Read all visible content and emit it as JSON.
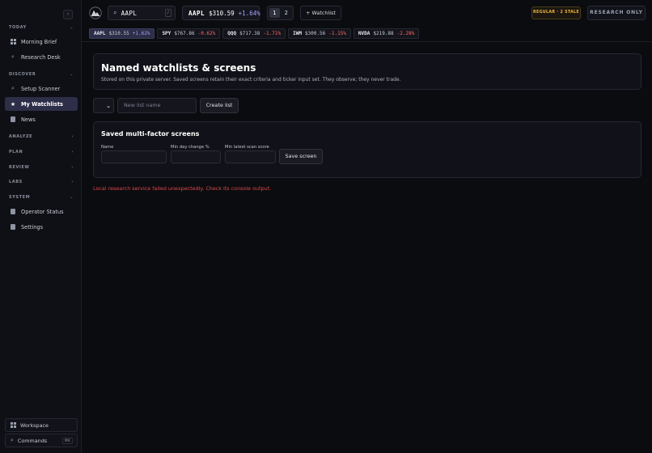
{
  "sidebar": {
    "collapse_glyph": "‹",
    "sections": [
      {
        "title": "TODAY",
        "chevron": "⌄"
      },
      {
        "title": "DISCOVER",
        "chevron": "⌄"
      },
      {
        "title": "ANALYZE",
        "chevron": "›"
      },
      {
        "title": "PLAN",
        "chevron": "›"
      },
      {
        "title": "REVIEW",
        "chevron": "›"
      },
      {
        "title": "LABS",
        "chevron": "›"
      },
      {
        "title": "SYSTEM",
        "chevron": "⌄"
      }
    ],
    "items": [
      {
        "label": "Morning Brief",
        "icon": "grid-icon"
      },
      {
        "label": "Research Desk",
        "icon": "search-icon"
      },
      {
        "label": "Setup Scanner",
        "icon": "search-icon"
      },
      {
        "label": "My Watchlists",
        "icon": "star-icon",
        "active": true
      },
      {
        "label": "News",
        "icon": "document-icon"
      },
      {
        "label": "Operator Status",
        "icon": "document-icon"
      },
      {
        "label": "Settings",
        "icon": "document-icon"
      }
    ],
    "bottom": {
      "workspace_label": "Workspace",
      "commands_label": "Commands",
      "commands_shortcut": "⌘K"
    }
  },
  "topbar": {
    "search_value": "AAPL",
    "search_shortcut": "/",
    "quote": {
      "symbol": "AAPL",
      "price": "$310.59",
      "change": "+1.64%"
    },
    "pages": [
      "1",
      "2"
    ],
    "active_page": "1",
    "watchlist_button": "+ Watchlist",
    "session_badge": "REGULAR · 2 STALE",
    "mode_badge": "RESEARCH ONLY"
  },
  "tickers": [
    {
      "symbol": "AAPL",
      "price": "$310.55",
      "change": "+1.62%",
      "direction": "up",
      "active": true
    },
    {
      "symbol": "SPY",
      "price": "$767.86",
      "change": "-0.62%",
      "direction": "down"
    },
    {
      "symbol": "QQQ",
      "price": "$717.38",
      "change": "-1.71%",
      "direction": "down"
    },
    {
      "symbol": "IWM",
      "price": "$300.56",
      "change": "-1.15%",
      "direction": "down"
    },
    {
      "symbol": "NVDA",
      "price": "$219.88",
      "change": "-2.28%",
      "direction": "down"
    }
  ],
  "main": {
    "hero": {
      "title": "Named watchlists & screens",
      "subtitle": "Stored on this private server. Saved screens retain their exact criteria and ticker input set. They observe; they never trade."
    },
    "list_form": {
      "new_list_placeholder": "New list name",
      "create_button": "Create list"
    },
    "screens": {
      "title": "Saved multi-factor screens",
      "fields": [
        "Name",
        "Min day change %",
        "Min latest scan score"
      ],
      "save_button": "Save screen"
    },
    "error": "Local research service failed unexpectedly. Check its console output."
  },
  "colors": {
    "accent": "#a6a2ff",
    "negative": "#ff6b6b",
    "warning": "#f0b43c",
    "error": "#e04848",
    "active_bg": "#2d2e48"
  }
}
